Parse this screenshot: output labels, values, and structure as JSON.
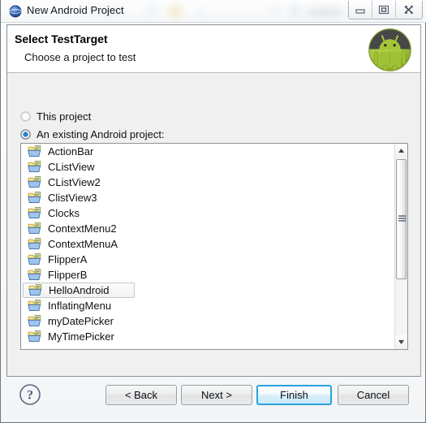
{
  "window": {
    "title": "New Android Project",
    "icon": "eclipse-globe-icon",
    "controls": {
      "minimize_label": "Minimize",
      "restore_label": "Restore",
      "close_label": "Close"
    }
  },
  "header": {
    "title": "Select TestTarget",
    "subtitle": "Choose a project to test",
    "logo": "android-robot-icon"
  },
  "options": {
    "this_project": {
      "label": "This project",
      "selected": false
    },
    "existing_project": {
      "label": "An existing Android project:",
      "selected": true
    }
  },
  "project_list": {
    "selected": "HelloAndroid",
    "items": [
      {
        "label": "ActionBar"
      },
      {
        "label": "CListView"
      },
      {
        "label": "CListView2"
      },
      {
        "label": "ClistView3"
      },
      {
        "label": "Clocks"
      },
      {
        "label": "ContextMenu2"
      },
      {
        "label": "ContextMenuA"
      },
      {
        "label": "FlipperA"
      },
      {
        "label": "FlipperB"
      },
      {
        "label": "HelloAndroid"
      },
      {
        "label": "InflatingMenu"
      },
      {
        "label": "myDatePicker"
      },
      {
        "label": "MyTimePicker"
      }
    ]
  },
  "scrollbar": {
    "up_arrow": "scroll-up-icon",
    "down_arrow": "scroll-down-icon"
  },
  "buttons": {
    "help": "?",
    "back": "< Back",
    "next": "Next >",
    "finish": "Finish",
    "cancel": "Cancel"
  },
  "colors": {
    "accent_blue": "#2aa3dd",
    "android_green": "#a4c639",
    "header_bg": "#ffffff",
    "dialog_bg": "#f0f0f0"
  }
}
